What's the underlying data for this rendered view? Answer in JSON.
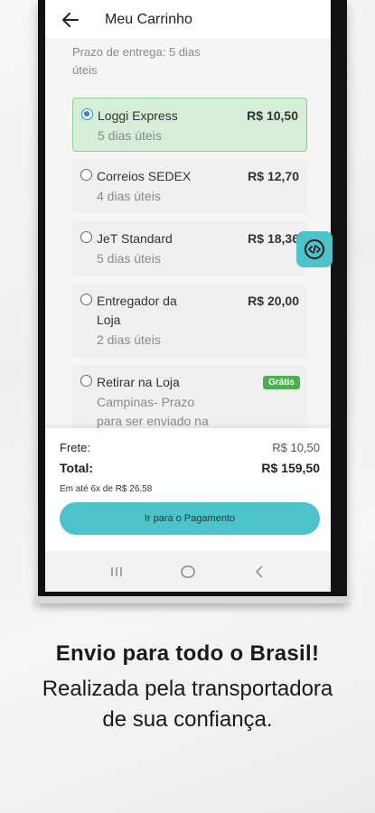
{
  "header": {
    "title": "Meu Carrinho"
  },
  "top_note": "Prazo de entrega: 5 dias úteis",
  "shipping_options": [
    {
      "name": "Loggi Express",
      "sub": "5 dias úteis",
      "price": "R$ 10,50",
      "selected": true
    },
    {
      "name": "Correios SEDEX",
      "sub": "4 dias úteis",
      "price": "R$ 12,70",
      "selected": false
    },
    {
      "name": "JeT Standard",
      "sub": "5 dias úteis",
      "price": "R$ 18,36",
      "selected": false
    },
    {
      "name": "Entregador da Loja",
      "sub": "2 dias úteis",
      "price": "R$ 20,00",
      "selected": false
    },
    {
      "name": "Retirar na Loja",
      "sub": "Campinas- Prazo para ser enviado na",
      "badge": "Grátis",
      "selected": false
    }
  ],
  "summary": {
    "frete_label": "Frete:",
    "frete_value": "R$ 10,50",
    "total_label": "Total:",
    "total_value": "R$ 159,50",
    "installments": "Em até 6x de R$ 26,58",
    "pay_button": "Ir para o Pagamento"
  },
  "caption": {
    "title": "Envio para todo o Brasil!",
    "line1": "Realizada pela transportadora",
    "line2": "de sua confiança."
  },
  "colors": {
    "accent": "#4cc3c9",
    "selected_bg": "#d6eed8",
    "badge": "#4caf50",
    "radio_selected": "#2a8cc7"
  },
  "icons": [
    "back-arrow-icon",
    "code-icon",
    "recent-apps-icon",
    "home-icon",
    "back-nav-icon"
  ]
}
